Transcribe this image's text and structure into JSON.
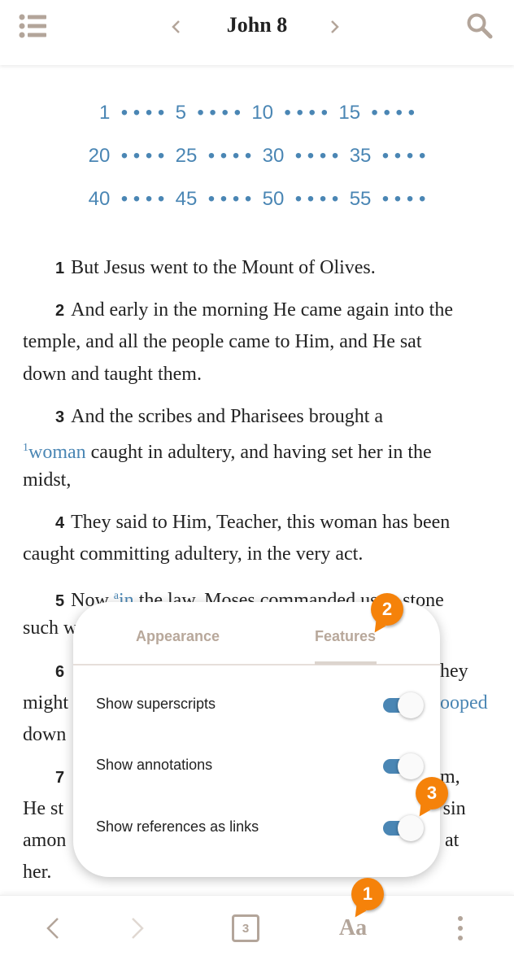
{
  "header": {
    "title": "John 8",
    "icons": {
      "menu": "list-icon",
      "prev": "chevron-left-icon",
      "next": "chevron-right-icon",
      "search": "search-icon"
    }
  },
  "verse_nav": {
    "rows": [
      [
        "1",
        "5",
        "10",
        "15"
      ],
      [
        "20",
        "25",
        "30",
        "35"
      ],
      [
        "40",
        "45",
        "50",
        "55"
      ]
    ],
    "dot": "• • • •"
  },
  "text": {
    "v1": {
      "num": "1",
      "l1": "But Jesus went to the Mount of Olives."
    },
    "v2": {
      "num": "2",
      "l1": "And early in the morning He came again into the",
      "l2": "temple, and all the people came to Him, and He sat",
      "l3": "down and taught them."
    },
    "v3": {
      "num": "3",
      "l1": "And the scribes and Pharisees brought a",
      "sup": "1",
      "link": "woman",
      "l2": " caught in adultery, and having set her in the",
      "l3": "midst,"
    },
    "v4": {
      "num": "4",
      "l1": "They said to Him, Teacher, this woman has been",
      "l2": "caught committing adultery, in the very act."
    },
    "v5": {
      "num": "5",
      "pre": "Now ",
      "sup": "a",
      "link": "in",
      "l1": " the law, Moses commanded us to stone",
      "l2": "such w"
    },
    "v6": {
      "num": "6",
      "r1": "hey",
      "l2": "might",
      "r2": "ooped",
      "l3": "down"
    },
    "v7": {
      "num": "7",
      "r1": "m,",
      "l2": "He st",
      "r2": "t sin",
      "l3": "amon",
      "r3": " at",
      "l4": "her."
    }
  },
  "popup": {
    "tabs": [
      "Appearance",
      "Features"
    ],
    "active_tab": "Features",
    "settings": [
      {
        "label": "Show superscripts",
        "on": true
      },
      {
        "label": "Show annotations",
        "on": true
      },
      {
        "label": "Show references as links",
        "on": true
      }
    ]
  },
  "bottom_bar": {
    "chapter_count": "3",
    "font_label": "Aa",
    "icons": [
      "back-icon",
      "forward-icon",
      "parallel-icon",
      "font-size-icon",
      "more-icon"
    ]
  },
  "badges": [
    "1",
    "2",
    "3"
  ],
  "colors": {
    "accent": "#4a86b4",
    "badge": "#f5820a",
    "icon": "#b3a59a"
  }
}
